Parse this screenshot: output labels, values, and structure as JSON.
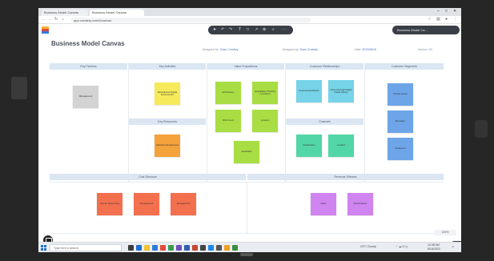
{
  "browser": {
    "tabs": [
      {
        "label": "Business Model Canvas"
      },
      {
        "label": "Business Model Canvas"
      }
    ],
    "url": "app.creately.com/d/canvas",
    "window_controls": [
      "–",
      "□",
      "✕"
    ]
  },
  "app": {
    "toolbar_icons": [
      "pointer-icon",
      "undo-icon",
      "redo-icon",
      "text-icon",
      "shape-icon",
      "connector-icon",
      "zoom-icon",
      "search-icon",
      "more-icon"
    ],
    "share_label": "Business Model Ca...",
    "title": "Business Model Canvas",
    "meta": [
      {
        "label": "Designed for:",
        "value": "Team Creately"
      },
      {
        "label": "Designed by:",
        "value": "Team Creately"
      },
      {
        "label": "Date:",
        "value": "2023/08/16"
      },
      {
        "label": "Version:",
        "value": "V1"
      }
    ],
    "sections": {
      "key_partners": "Key Partners",
      "key_activities": "Key Activities",
      "key_resources": "Key Resources",
      "value_propositions": "Value Propositions",
      "customer_relationships": "Customer Relationships",
      "channels": "Channels",
      "customer_segments": "Customer Segments",
      "cost_structure": "Cost Structure",
      "revenue_streams": "Revenue Streams"
    },
    "notes": {
      "key_partners": [
        "Management"
      ],
      "key_activities": [
        "Manufacture Digital Environment"
      ],
      "key_resources": [
        "Software Development"
      ],
      "value_propositions": [
        "Gift Delivery",
        "Quantitative Thinking Innovation",
        "Work hours",
        "Location",
        "Feedback"
      ],
      "customer_relationships": [
        "Personal Assistance",
        "Attend through Digital Media Library"
      ],
      "channels": [
        "Registration",
        "Location"
      ],
      "customer_segments": [
        "Private sector",
        "Education",
        "Audiences"
      ],
      "cost_structure": [
        "Human Resourcing",
        "Development",
        "Management"
      ],
      "revenue_streams": [
        "Sales",
        "Subscriptions"
      ]
    },
    "zoom_label": "100%",
    "help_label": "?"
  },
  "taskbar": {
    "search_placeholder": "Type here to search",
    "weather": "24°C Cloudy",
    "time": "10:38 AM",
    "date": "8/16/2023"
  },
  "colors": {
    "sticky_gray": "#d3d3d3",
    "sticky_yellow": "#f6ea5a",
    "sticky_orange": "#f4a23b",
    "sticky_green": "#a8de43",
    "sticky_cyan": "#76d3e8",
    "sticky_teal": "#53d6a7",
    "sticky_blue": "#6ea5e8",
    "sticky_red": "#f3704e",
    "sticky_purple": "#cf84f0",
    "header_band": "#dbe6f3"
  }
}
